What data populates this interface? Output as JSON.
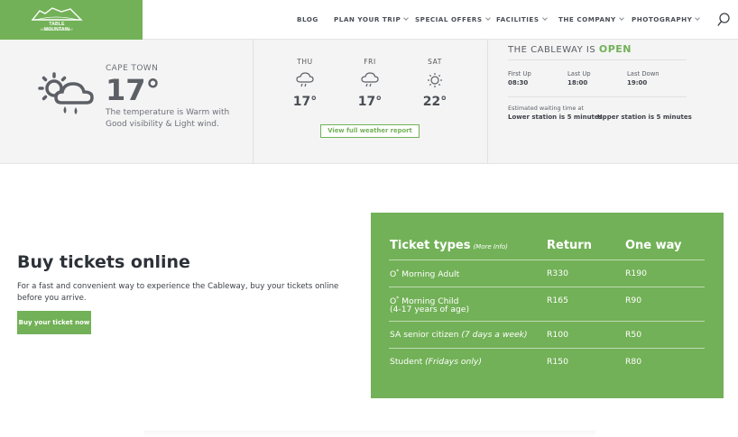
{
  "logo": {
    "line1": "TABLE MOUNTAIN",
    "line2": "AERIAL CABLEWAY"
  },
  "nav": {
    "items": [
      {
        "label": "BLOG"
      },
      {
        "label": "PLAN YOUR TRIP"
      },
      {
        "label": "SPECIAL OFFERS"
      },
      {
        "label": "FACILITIES"
      },
      {
        "label": "THE COMPANY"
      },
      {
        "label": "PHOTOGRAPHY"
      }
    ]
  },
  "weather": {
    "city": "CAPE TOWN",
    "temp": "17°",
    "description": "The temperature is Warm with Good visibility & Light wind.",
    "forecast": [
      {
        "day": "THU",
        "temp": "17°",
        "icon": "cloud-rain-icon"
      },
      {
        "day": "FRI",
        "temp": "17°",
        "icon": "cloud-rain-icon"
      },
      {
        "day": "SAT",
        "temp": "22°",
        "icon": "sun-icon"
      }
    ],
    "report_button": "View full weather report"
  },
  "cableway": {
    "title": "THE CABLEWAY IS",
    "status": "OPEN",
    "first_up_label": "First Up",
    "first_up": "08:30",
    "last_up_label": "Last Up",
    "last_up": "18:00",
    "last_down_label": "Last Down",
    "last_down": "19:00",
    "wait_label": "Estimated waiting time at",
    "lower": "Lower station is 5 minutes",
    "upper": "Upper station is 5 minutes"
  },
  "buy": {
    "title": "Buy tickets online",
    "description": "For a fast and convenient way to experience the Cableway, buy your tickets online before you arrive.",
    "button": "Buy your ticket now"
  },
  "tickets": {
    "header_type": "Ticket types",
    "more_info": "(More Info)",
    "header_return": "Return",
    "header_oneway": "One way",
    "rows": [
      {
        "name": "O",
        "sup": "*",
        "name_rest": " Morning Adult",
        "sub": "",
        "ret": "R330",
        "one": "R190"
      },
      {
        "name": "O",
        "sup": "*",
        "name_rest": " Morning Child",
        "sub": "(4-17 years of age)",
        "ret": "R165",
        "one": "R90"
      },
      {
        "name": "SA senior citizen ",
        "sup": "",
        "name_rest": "",
        "italic": "(7 days a week)",
        "ret": "R100",
        "one": "R50"
      },
      {
        "name": "Student ",
        "sup": "",
        "name_rest": "",
        "italic": "(Fridays only)",
        "ret": "R150",
        "one": "R80"
      }
    ]
  },
  "colors": {
    "accent": "#72b157",
    "band": "#f4f4f4",
    "text": "#3d4148"
  }
}
